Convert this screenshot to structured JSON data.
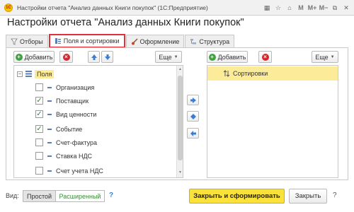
{
  "window": {
    "title": "Настройки отчета \"Анализ данных Книги покупок\"  (1С:Предприятие)",
    "logo_text": "1С",
    "icons": [
      "grid-icon",
      "star-icon",
      "home-icon",
      "m-icon",
      "m-plus-icon",
      "m-minus-icon",
      "restore-icon",
      "close-icon"
    ],
    "icon_glyphs": [
      "▦",
      "☆",
      "⌂",
      "M",
      "M+",
      "M−",
      "⧉",
      "✕"
    ]
  },
  "form": {
    "title": "Настройки отчета \"Анализ данных Книги покупок\""
  },
  "tabs": [
    {
      "label": "Отборы",
      "icon": "filter-icon",
      "active": false
    },
    {
      "label": "Поля и сортировки",
      "icon": "fields-sort-icon",
      "active": true
    },
    {
      "label": "Оформление",
      "icon": "brush-icon",
      "active": false
    },
    {
      "label": "Структура",
      "icon": "structure-icon",
      "active": false
    }
  ],
  "left_toolbar": {
    "add_label": "Добавить",
    "more_label": "Еще"
  },
  "right_toolbar": {
    "add_label": "Добавить",
    "more_label": "Еще"
  },
  "fields": {
    "root_label": "Поля",
    "items": [
      {
        "label": "Организация",
        "checked": false
      },
      {
        "label": "Поставщик",
        "checked": true
      },
      {
        "label": "Вид ценности",
        "checked": true
      },
      {
        "label": "Событие",
        "checked": true
      },
      {
        "label": "Счет-фактура",
        "checked": false
      },
      {
        "label": "Ставка НДС",
        "checked": false
      },
      {
        "label": "Счет учета НДС",
        "checked": false
      }
    ]
  },
  "sorting": {
    "root_label": "Сортировки"
  },
  "bottom": {
    "view_label": "Вид:",
    "simple_label": "Простой",
    "extended_label": "Расширенный",
    "help": "?",
    "primary_label": "Закрыть и сформировать",
    "close_label": "Закрыть",
    "help2": "?"
  },
  "colors": {
    "active_tab_border": "#e0303a",
    "highlight": "#fcec9a",
    "primary_button": "#fbe23a",
    "check_green": "#2d8a2d",
    "arrow_blue": "#3a7fcf"
  }
}
